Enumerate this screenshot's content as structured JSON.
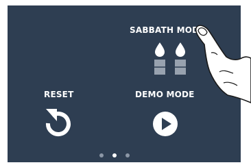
{
  "sabbath_mode": {
    "label": "SABBATH MODE",
    "icon": "candles-icon"
  },
  "reset": {
    "label": "RESET",
    "icon": "reset-arrow-icon"
  },
  "demo_mode": {
    "label": "DEMO MODE",
    "icon": "play-icon"
  },
  "pagination": {
    "page_count": 3,
    "current_page": 2
  },
  "colors": {
    "background": "#2e3e52",
    "foreground": "#ffffff",
    "candle_base": "#98a2af",
    "dot_inactive": "#8c97a6"
  }
}
